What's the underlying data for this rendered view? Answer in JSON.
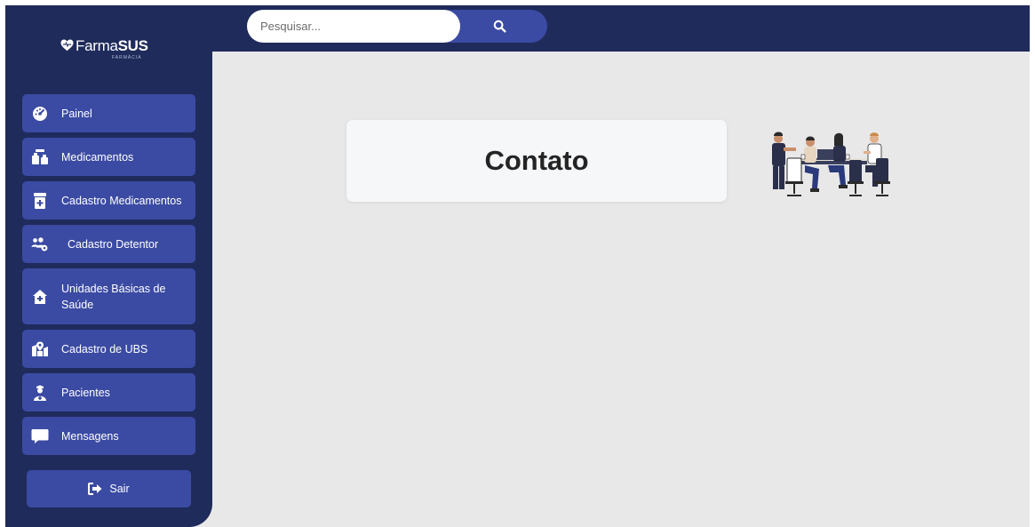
{
  "brand": {
    "name_thin": "Farma",
    "name_bold": "SUS",
    "subtitle": "FARMÁCIA"
  },
  "search": {
    "placeholder": "Pesquisar...",
    "button_icon": "search-icon"
  },
  "sidebar": {
    "items": [
      {
        "label": "Painel",
        "icon": "dashboard-gauge-icon"
      },
      {
        "label": "Medicamentos",
        "icon": "medicine-bottles-icon"
      },
      {
        "label": "Cadastro Medicamentos",
        "icon": "prescription-bottle-icon"
      },
      {
        "label": "Cadastro Detentor",
        "icon": "users-cog-icon"
      },
      {
        "label": "Unidades Básicas de Saúde",
        "icon": "house-medical-icon"
      },
      {
        "label": "Cadastro de UBS",
        "icon": "map-location-icon"
      },
      {
        "label": "Pacientes",
        "icon": "user-nurse-icon"
      },
      {
        "label": "Mensagens",
        "icon": "message-icon"
      }
    ],
    "logout_label": "Sair",
    "logout_icon": "sign-out-icon"
  },
  "main": {
    "title": "Contato",
    "illustration": "team-meeting-illustration"
  },
  "colors": {
    "sidebar_bg": "#1f2b5b",
    "item_bg": "#3b4ba3",
    "page_bg": "#e8e8e8",
    "card_bg": "#f6f7f9"
  }
}
